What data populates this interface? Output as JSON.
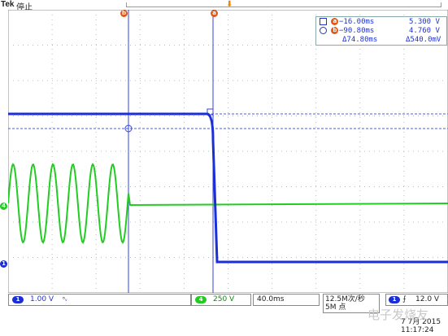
{
  "header": {
    "brand": "Tek",
    "run_state": "停止"
  },
  "cursors": {
    "a_label": "a",
    "b_label": "b"
  },
  "readout": {
    "a_time": "−16.00ms",
    "a_volt": "5.300 V",
    "b_time": "−90.80ms",
    "b_volt": "4.760 V",
    "delta_time": "Δ74.80ms",
    "delta_volt": "Δ540.0mV"
  },
  "channels": {
    "ch1": {
      "number": "1",
      "scale": "1.00 V",
      "color": "#1a2fd8"
    },
    "ch4": {
      "number": "4",
      "scale": "250 V",
      "color": "#22cc22"
    }
  },
  "timebase": {
    "scale": "40.0ms"
  },
  "acquisition": {
    "sample_rate": "12.5M次/秒",
    "record_length": "5M 点"
  },
  "trigger": {
    "source": "1",
    "level": "12.0 V"
  },
  "clock": {
    "date": "7 7月 2015",
    "time": "11:17:24"
  },
  "watermark": "电子发烧友"
}
